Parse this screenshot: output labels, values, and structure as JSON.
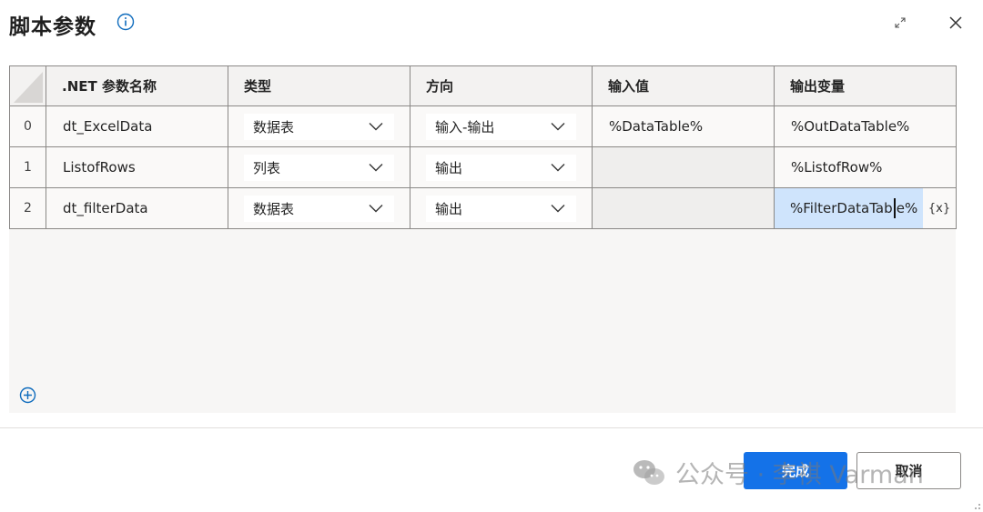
{
  "dialog": {
    "title": "脚本参数"
  },
  "table": {
    "headers": {
      "name": ".NET 参数名称",
      "type": "类型",
      "direction": "方向",
      "input_value": "输入值",
      "output_variable": "输出变量"
    },
    "rows": [
      {
        "index": "0",
        "name": "dt_ExcelData",
        "type": "数据表",
        "direction": "输入-输出",
        "input_value": "%DataTable%",
        "output_variable": "%OutDataTable%"
      },
      {
        "index": "1",
        "name": "ListofRows",
        "type": "列表",
        "direction": "输出",
        "input_value": "",
        "output_variable": "%ListofRow%"
      },
      {
        "index": "2",
        "name": "dt_filterData",
        "type": "数据表",
        "direction": "输出",
        "input_value": "",
        "output_variable": "%FilterDataTable%"
      }
    ],
    "variable_button": "{x}"
  },
  "footer": {
    "done_label": "完成",
    "cancel_label": "取消",
    "watermark_text": "公众号 · 李祺 Varman"
  },
  "colors": {
    "primary": "#1472e8",
    "active_cell": "#cfe4fc",
    "info_icon": "#0f6cbd"
  },
  "icons": [
    "info-icon",
    "expand-icon",
    "close-icon",
    "chevron-down-icon",
    "add-icon",
    "wechat-logo-icon"
  ]
}
